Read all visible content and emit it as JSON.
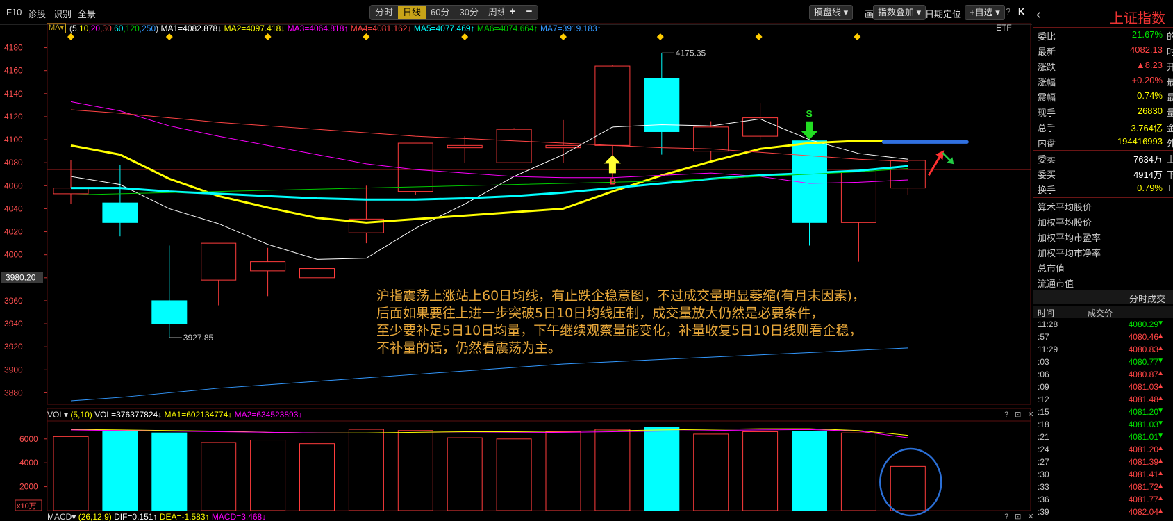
{
  "toolbar": {
    "f10": "F10",
    "diagnose": "诊股",
    "identify": "识别",
    "fullview": "全景",
    "periods": [
      "分时",
      "日线",
      "60分",
      "30分",
      "周线 ▾"
    ],
    "active_period": 1,
    "zoom_in": "+",
    "zoom_out": "−",
    "pan_label": "摸盘线 ▾",
    "draw_label": "画线",
    "overlay_label": "指数叠加 ▾",
    "date_locate": "日期定位",
    "add_watch": "+自选 ▾",
    "help_icon": "?",
    "collapse_icon": "K"
  },
  "ma_legend": {
    "dropdown": "MA▾",
    "params_open": "(",
    "params": [
      {
        "text": "5",
        "color": "#ffffff"
      },
      {
        "text": ",10",
        "color": "#ffff00"
      },
      {
        "text": ",20",
        "color": "#ff00ff"
      },
      {
        "text": ",30",
        "color": "#ff4444"
      },
      {
        "text": ",60",
        "color": "#00ffff"
      },
      {
        "text": ",120",
        "color": "#00cc00"
      },
      {
        "text": ",250",
        "color": "#3399ff"
      }
    ],
    "params_close": ")",
    "items": [
      {
        "text": "MA1=4082.878↓",
        "color": "#ffffff"
      },
      {
        "text": "MA2=4097.418↓",
        "color": "#ffff00"
      },
      {
        "text": "MA3=4064.818↑",
        "color": "#ff00ff"
      },
      {
        "text": "MA4=4081.162↓",
        "color": "#ff4444"
      },
      {
        "text": "MA5=4077.469↑",
        "color": "#00ffff"
      },
      {
        "text": "MA6=4074.664↑",
        "color": "#00cc00"
      },
      {
        "text": "MA7=3919.183↑",
        "color": "#3399ff"
      }
    ],
    "etf": "ETF"
  },
  "colors": {
    "up": "#ff3c3c",
    "down": "#00ffff",
    "ma5": "#ffffff",
    "ma10": "#ffff00",
    "ma20": "#ff00ff",
    "ma30": "#ff4444",
    "ma60": "#00ffff",
    "ma120": "#00cc00",
    "ma250": "#3399ff",
    "grid": "#5a0f0f",
    "annotation": "#e8a83a"
  },
  "chart_data": [
    {
      "type": "candlestick",
      "title": "",
      "ylim": [
        3870,
        4190
      ],
      "yticks": [
        3880,
        3900,
        3920,
        3940,
        3960,
        3980,
        4000,
        4020,
        4040,
        4060,
        4080,
        4100,
        4120,
        4140,
        4160,
        4180
      ],
      "current_price_label": "3980.20",
      "candles": [
        {
          "o": 4053,
          "c": 4058,
          "h": 4082,
          "l": 4044
        },
        {
          "o": 4045,
          "c": 4028,
          "h": 4078,
          "l": 4016
        },
        {
          "o": 3960,
          "c": 3940,
          "h": 4008,
          "l": 3928
        },
        {
          "o": 3978,
          "c": 4010,
          "h": 4010,
          "l": 3956
        },
        {
          "o": 3986,
          "c": 3994,
          "h": 4006,
          "l": 3964
        },
        {
          "o": 3980,
          "c": 3988,
          "h": 3994,
          "l": 3960
        },
        {
          "o": 4019,
          "c": 4031,
          "h": 4060,
          "l": 4010
        },
        {
          "o": 4055,
          "c": 4097,
          "h": 4097,
          "l": 4052
        },
        {
          "o": 4093,
          "c": 4095,
          "h": 4103,
          "l": 4080
        },
        {
          "o": 4080,
          "c": 4109,
          "h": 4110,
          "l": 4080
        },
        {
          "o": 4093,
          "c": 4095,
          "h": 4117,
          "l": 4080
        },
        {
          "o": 4095,
          "c": 4164,
          "h": 4165,
          "l": 4066
        },
        {
          "o": 4153,
          "c": 4107,
          "h": 4175.35,
          "l": 4087
        },
        {
          "o": 4090,
          "c": 4111,
          "h": 4116,
          "l": 4080
        },
        {
          "o": 4103,
          "c": 4119,
          "h": 4132,
          "l": 4100
        },
        {
          "o": 4099,
          "c": 4028,
          "h": 4099,
          "l": 4008
        },
        {
          "o": 4028,
          "c": 4072,
          "h": 4072,
          "l": 3994
        },
        {
          "o": 4058,
          "c": 4082,
          "h": 4082,
          "l": 4052
        }
      ],
      "ma_lines": [
        {
          "name": "MA5",
          "color": "#ffffff",
          "values": [
            4068,
            4061,
            4040,
            4027,
            4009,
            3996,
            3997,
            4023,
            4044,
            4068,
            4087,
            4111,
            4113,
            4112,
            4118,
            4100,
            4088,
            4083
          ]
        },
        {
          "name": "MA10",
          "color": "#ffff00",
          "values": [
            4095,
            4087,
            4066,
            4051,
            4041,
            4032,
            4028,
            4031,
            4034,
            4037,
            4040,
            4055,
            4069,
            4081,
            4092,
            4097,
            4099,
            4098
          ]
        },
        {
          "name": "MA20",
          "color": "#ff00ff",
          "values": [
            4133,
            4125,
            4112,
            4103,
            4095,
            4087,
            4079,
            4074,
            4071,
            4068,
            4067,
            4067,
            4069,
            4071,
            4068,
            4062,
            4063,
            4065
          ]
        },
        {
          "name": "MA30",
          "color": "#ff4444",
          "values": [
            4126,
            4123,
            4119,
            4115,
            4112,
            4109,
            4106,
            4103,
            4101,
            4099,
            4097,
            4095,
            4093,
            4092,
            4089,
            4086,
            4083,
            4081
          ]
        },
        {
          "name": "MA60",
          "color": "#00ffff",
          "values": [
            4058,
            4058,
            4055,
            4053,
            4051,
            4049,
            4048,
            4048,
            4049,
            4051,
            4054,
            4058,
            4062,
            4066,
            4069,
            4071,
            4073,
            4077
          ]
        },
        {
          "name": "MA120",
          "color": "#00cc00",
          "values": [
            4052,
            4053,
            4054,
            4055,
            4056,
            4057,
            4058,
            4059,
            4060,
            4061,
            4062,
            4063,
            4064,
            4066,
            4068,
            4070,
            4072,
            4075
          ]
        },
        {
          "name": "MA250",
          "color": "#3399ff",
          "values": [
            3873,
            3876,
            3880,
            3884,
            3887,
            3890,
            3893,
            3896,
            3899,
            3902,
            3905,
            3907,
            3909,
            3911,
            3913,
            3915,
            3917,
            3919
          ]
        }
      ],
      "high_label": "4175.35",
      "low_label": "3927.85",
      "hline": 4074,
      "buy_signal": {
        "candle": 11,
        "label": "B"
      },
      "sell_signal": {
        "candle": 15,
        "label": "S"
      },
      "target_line": {
        "value": 4098
      }
    },
    {
      "type": "bar",
      "title": "VOL",
      "ylim": [
        0,
        7500
      ],
      "yticks": [
        2000,
        4000,
        6000
      ],
      "unit_label": "x10万",
      "values": [
        6200,
        6600,
        6500,
        5700,
        5900,
        5600,
        6800,
        6700,
        6100,
        6000,
        6600,
        6800,
        7000,
        6400,
        6600,
        6600,
        6500,
        3700
      ],
      "ma5": [
        6800,
        6750,
        6700,
        6650,
        6550,
        6500,
        6500,
        6550,
        6600,
        6600,
        6650,
        6680,
        6750,
        6800,
        6850,
        6850,
        6700,
        6300
      ],
      "ma10": [
        6750,
        6700,
        6650,
        6600,
        6550,
        6500,
        6480,
        6480,
        6500,
        6520,
        6550,
        6600,
        6650,
        6700,
        6750,
        6780,
        6650,
        6100
      ]
    }
  ],
  "vol_header": {
    "dropdown": "VOL▾",
    "params": "(5,10)",
    "vol": "VOL=376377824↓",
    "ma1": "MA1=602134774↓",
    "ma2": "MA2=634523893↓",
    "icons": "? ⊡ ✕"
  },
  "macd_header": {
    "dropdown": "MACD▾",
    "params": "(26,12,9)",
    "dif": "DIF=0.151↑",
    "dea": "DEA=-1.583↑",
    "macd": "MACD=3.468↓",
    "icons": "? ⊡ ✕"
  },
  "annotation": {
    "lines": [
      "沪指震荡上涨站上60日均线，有止跌企稳意图，不过成交量明显萎缩(有月末因素)，",
      "后面如果要往上进一步突破5日10日均线压制，成交量放大仍然是必要条件，",
      "至少要补足5日10日均量，下午继续观察量能变化，补量收复5日10日线则看企稳，",
      "不补量的话，仍然看震荡为主。"
    ]
  },
  "side": {
    "title": "上证指数",
    "back": "‹",
    "rows": [
      {
        "label": "委比",
        "value": "-21.67%",
        "color": "green",
        "clip": "的"
      },
      {
        "label": "最新",
        "value": "4082.13",
        "color": "red",
        "clip": "时"
      },
      {
        "label": "涨跌",
        "value": "▲8.23",
        "color": "red",
        "clip": "开"
      },
      {
        "label": "涨幅",
        "value": "+0.20%",
        "color": "red",
        "clip": "最"
      },
      {
        "label": "震幅",
        "value": "0.74%",
        "color": "yellow",
        "clip": "最"
      },
      {
        "label": "现手",
        "value": "26830",
        "color": "yellow",
        "clip": "量"
      },
      {
        "label": "总手",
        "value": "3.764亿",
        "color": "yellow",
        "clip": "金"
      },
      {
        "label": "内盘",
        "value": "194416993",
        "color": "yellow",
        "clip": "外"
      }
    ],
    "rows2": [
      {
        "label": "委卖",
        "value": "7634万",
        "color": "white",
        "clip": "上"
      },
      {
        "label": "委买",
        "value": "4914万",
        "color": "white",
        "clip": "下"
      },
      {
        "label": "换手",
        "value": "0.79%",
        "color": "yellow",
        "clip": "T"
      }
    ],
    "texts": [
      "算术平均股价",
      "加权平均股价",
      "加权平均市盈率",
      "加权平均市净率",
      "总市值",
      "流通市值"
    ],
    "ticks_title": "分时成交",
    "ticks_head": {
      "time": "时间",
      "price": "成交价"
    },
    "ticks": [
      {
        "t": "11:28",
        "p": "4080.29",
        "d": "down"
      },
      {
        "t": ":57",
        "p": "4080.46",
        "d": "up"
      },
      {
        "t": "11:29",
        "p": "4080.83",
        "d": "up"
      },
      {
        "t": ":03",
        "p": "4080.77",
        "d": "down"
      },
      {
        "t": ":06",
        "p": "4080.87",
        "d": "up"
      },
      {
        "t": ":09",
        "p": "4081.03",
        "d": "up"
      },
      {
        "t": ":12",
        "p": "4081.48",
        "d": "up"
      },
      {
        "t": ":15",
        "p": "4081.20",
        "d": "down"
      },
      {
        "t": ":18",
        "p": "4081.03",
        "d": "down"
      },
      {
        "t": ":21",
        "p": "4081.01",
        "d": "down"
      },
      {
        "t": ":24",
        "p": "4081.20",
        "d": "up"
      },
      {
        "t": ":27",
        "p": "4081.39",
        "d": "up"
      },
      {
        "t": ":30",
        "p": "4081.41",
        "d": "up"
      },
      {
        "t": ":33",
        "p": "4081.72",
        "d": "up"
      },
      {
        "t": ":36",
        "p": "4081.77",
        "d": "up"
      },
      {
        "t": ":39",
        "p": "4082.04",
        "d": "up"
      }
    ]
  }
}
